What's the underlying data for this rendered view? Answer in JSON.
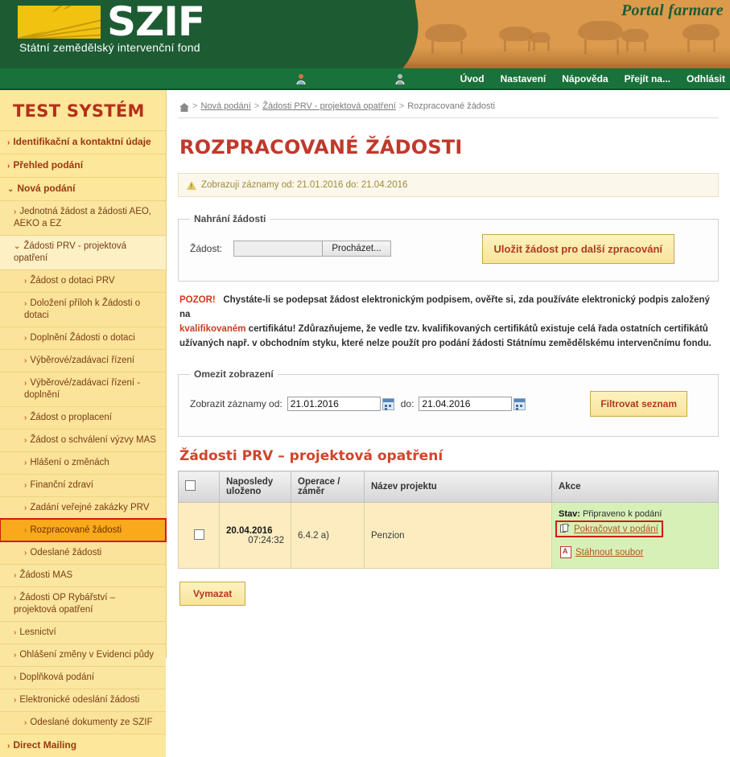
{
  "header": {
    "logo_text": "SZIF",
    "logo_subtitle": "Státní zemědělský intervenční fond",
    "portal_label": "Portal farmare",
    "nav": {
      "icons": [
        "user-profile-icon",
        "user-account-icon"
      ],
      "links": [
        "Úvod",
        "Nastavení",
        "Nápověda",
        "Přejít na...",
        "Odhlásit"
      ]
    }
  },
  "sidebar": {
    "title": "TEST SYSTÉM",
    "items": [
      {
        "label": "Identifikační a kontaktní údaje",
        "level": 0,
        "caret": "›",
        "selected": false
      },
      {
        "label": "Přehled podání",
        "level": 0,
        "caret": "›",
        "selected": false
      },
      {
        "label": "Nová podání",
        "level": 0,
        "caret": "⌄",
        "selected": false
      },
      {
        "label": "Jednotná žádost a žádosti AEO, AEKO a EZ",
        "level": 1,
        "caret": "›",
        "selected": false
      },
      {
        "label": "Žádosti PRV - projektová opatření",
        "level": 1,
        "caret": "⌄",
        "selected": false,
        "open": true
      },
      {
        "label": "Žádost o dotaci PRV",
        "level": 2,
        "caret": "›",
        "selected": false
      },
      {
        "label": "Doložení příloh k Žádosti o dotaci",
        "level": 2,
        "caret": "›",
        "selected": false
      },
      {
        "label": "Doplnění Žádosti o dotaci",
        "level": 2,
        "caret": "›",
        "selected": false
      },
      {
        "label": "Výběrové/zadávací řízení",
        "level": 2,
        "caret": "›",
        "selected": false
      },
      {
        "label": "Výběrové/zadávací řízení - doplnění",
        "level": 2,
        "caret": "›",
        "selected": false
      },
      {
        "label": "Žádost o proplacení",
        "level": 2,
        "caret": "›",
        "selected": false
      },
      {
        "label": "Žádost o schválení výzvy MAS",
        "level": 2,
        "caret": "›",
        "selected": false
      },
      {
        "label": "Hlášení o změnách",
        "level": 2,
        "caret": "›",
        "selected": false
      },
      {
        "label": "Finanční zdraví",
        "level": 2,
        "caret": "›",
        "selected": false
      },
      {
        "label": "Zadání veřejné zakázky PRV",
        "level": 2,
        "caret": "›",
        "selected": false
      },
      {
        "label": "Rozpracované žádosti",
        "level": 2,
        "caret": "›",
        "selected": true
      },
      {
        "label": "Odeslané žádosti",
        "level": 2,
        "caret": "›",
        "selected": false
      },
      {
        "label": "Žádosti MAS",
        "level": 1,
        "caret": "›",
        "selected": false
      },
      {
        "label": "Žádosti OP Rybářství – projektová opatření",
        "level": 1,
        "caret": "›",
        "selected": false
      },
      {
        "label": "Lesnictví",
        "level": 1,
        "caret": "›",
        "selected": false
      },
      {
        "label": "Ohlášení změny v Evidenci půdy",
        "level": 1,
        "caret": "›",
        "selected": false
      },
      {
        "label": "Doplňková podání",
        "level": 1,
        "caret": "›",
        "selected": false
      },
      {
        "label": "Elektronické odeslání žádosti",
        "level": 1,
        "caret": "›",
        "selected": false
      },
      {
        "label": "Odeslané dokumenty ze SZIF",
        "level": 2,
        "caret": "›",
        "selected": false
      },
      {
        "label": "Direct Mailing",
        "level": 0,
        "caret": "›",
        "selected": false
      }
    ]
  },
  "breadcrumb": {
    "home_icon": "home-icon",
    "items": [
      "Nová podání",
      "Žádosti PRV - projektová opatření",
      "Rozpracované žádosti"
    ],
    "separator": ">"
  },
  "page": {
    "title": "ROZPRACOVANÉ ŽÁDOSTI",
    "info_bar": "Zobrazuji záznamy od: 21.01.2016 do: 21.04.2016"
  },
  "upload": {
    "legend": "Nahrání žádosti",
    "field_label": "Žádost:",
    "file_value": "",
    "browse_label": "Procházet...",
    "submit_label": "Uložit žádost pro další zpracování"
  },
  "notice": {
    "prefix": "POZOR!",
    "line1_a": "Chystáte-li se podepsat žádost elektronickým podpisem, ověřte si, zda používáte elektronický podpis založený na",
    "line2_red": "kvalifikovaném",
    "line2_rest": "certifikátu! Zdůrazňujeme, že vedle tzv. kvalifikovaných certifikátů existuje celá řada ostatních certifikátů",
    "line3": "užívaných např. v obchodním styku, které nelze použít pro podání žádosti Státnímu zemědělskému intervenčnímu fondu."
  },
  "filter": {
    "legend": "Omezit zobrazení",
    "label": "Zobrazit záznamy od:",
    "date_from": "21.01.2016",
    "mid_label": "do:",
    "date_to": "21.04.2016",
    "button_label": "Filtrovat seznam"
  },
  "table": {
    "section_title": "Žádosti PRV – projektová opatření",
    "headers": [
      "",
      "Naposledy uloženo",
      "Operace / záměr",
      "Název projektu",
      "Akce"
    ],
    "rows": [
      {
        "date": "20.04.2016",
        "time": "07:24:32",
        "operation": "6.4.2 a)",
        "project_name": "Penzion",
        "stav_label": "Stav:",
        "stav_value": "Připraveno k podání",
        "action_continue": "Pokračovat v podání",
        "action_download": "Stáhnout soubor",
        "continue_icon": "document-continue-icon",
        "download_icon": "pdf-icon"
      }
    ]
  },
  "footer": {
    "delete_label": "Vymazat"
  },
  "colors": {
    "header_green": "#1d5c33",
    "nav_green": "#19723b",
    "sidebar_yellow": "#fce79a",
    "selected_orange": "#f9a91b",
    "highlight_red": "#d01d12",
    "title_red": "#c0392b",
    "row_yellow": "#fcecc0",
    "akce_green": "#d7f0b8"
  }
}
